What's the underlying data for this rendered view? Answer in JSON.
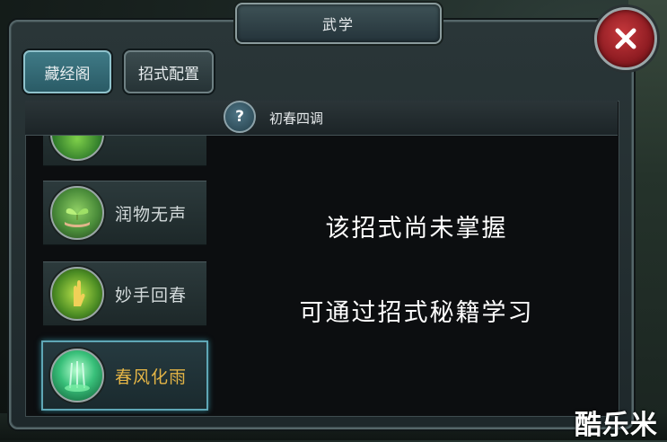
{
  "window": {
    "title": "武学"
  },
  "tabs": [
    {
      "label": "藏经阁",
      "active": true
    },
    {
      "label": "招式配置",
      "active": false
    }
  ],
  "header": {
    "help_icon": "?",
    "title": "初春四调"
  },
  "skills": [
    {
      "label": "",
      "icon": "green-skill-icon"
    },
    {
      "label": "润物无声",
      "icon": "sprout-hand-icon"
    },
    {
      "label": "妙手回春",
      "icon": "golden-hand-icon"
    },
    {
      "label": "春风化雨",
      "icon": "green-rain-icon",
      "selected": true
    }
  ],
  "message": {
    "line1": "该招式尚未掌握",
    "line2": "可通过招式秘籍学习"
  },
  "watermark": "酷乐米",
  "colors": {
    "accent": "#5fa7b6",
    "selected_text": "#e3b446",
    "close": "#b52a30"
  }
}
